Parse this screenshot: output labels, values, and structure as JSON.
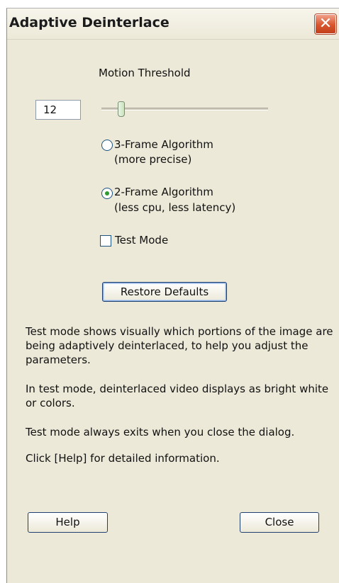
{
  "window": {
    "title": "Adaptive Deinterlace"
  },
  "motion_threshold": {
    "label": "Motion Threshold",
    "value": "12",
    "slider_level": 0.12
  },
  "algorithm": {
    "options": [
      {
        "line1": "3-Frame Algorithm",
        "line2": "(more precise)",
        "selected": false
      },
      {
        "line1": "2-Frame Algorithm",
        "line2": "(less cpu, less latency)",
        "selected": true
      }
    ]
  },
  "test_mode": {
    "label": "Test Mode",
    "checked": false
  },
  "buttons": {
    "restore_defaults": "Restore Defaults",
    "help": "Help",
    "close": "Close"
  },
  "info": {
    "p1": "Test mode shows visually which portions of the image are being adaptively deinterlaced, to help you adjust the parameters.",
    "p2": "In test mode, deinterlaced video displays as bright white or colors.",
    "p3": "Test mode always exits when you close the dialog.",
    "p4": "Click [Help] for detailed information."
  },
  "icons": {
    "close": "close-x-icon"
  }
}
